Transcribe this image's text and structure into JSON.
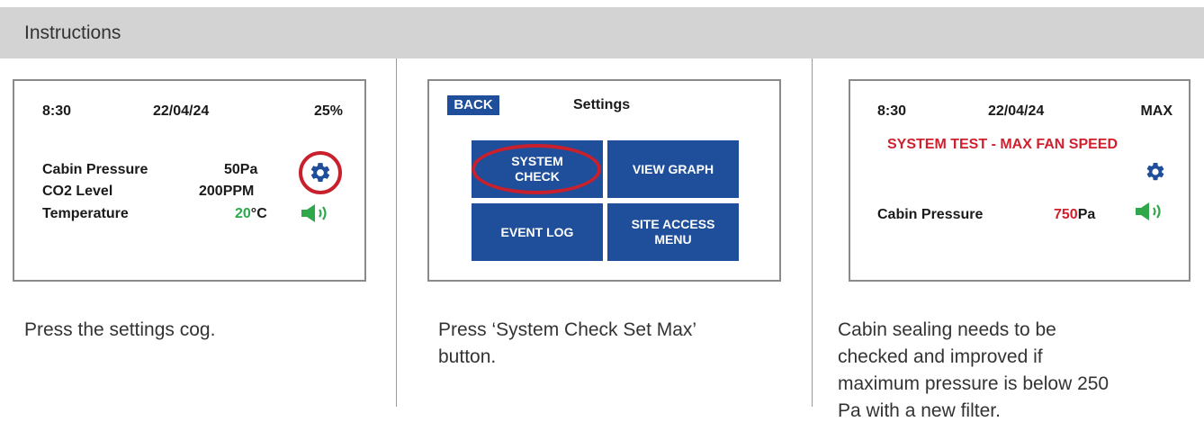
{
  "header": {
    "title": "Instructions"
  },
  "panel1": {
    "time": "8:30",
    "date": "22/04/24",
    "level": "25%",
    "rows": [
      {
        "label": "Cabin Pressure",
        "value": "50Pa"
      },
      {
        "label": "CO2 Level",
        "value": "200PPM"
      },
      {
        "label": "Temperature",
        "value_num": "20",
        "value_unit": "°C"
      }
    ],
    "caption": "Press the settings cog."
  },
  "panel2": {
    "back_label": "BACK",
    "title": "Settings",
    "buttons": [
      {
        "line1": "SYSTEM",
        "line2": "CHECK"
      },
      {
        "line1": "VIEW GRAPH",
        "line2": ""
      },
      {
        "line1": "EVENT LOG",
        "line2": ""
      },
      {
        "line1": "SITE ACCESS",
        "line2": "MENU"
      }
    ],
    "caption_line1": "Press ‘System Check Set Max’",
    "caption_line2": "button."
  },
  "panel3": {
    "time": "8:30",
    "date": "22/04/24",
    "level": "MAX",
    "alert": "SYSTEM TEST - MAX FAN SPEED",
    "pressure_label": "Cabin Pressure",
    "pressure_num": "750",
    "pressure_unit": "Pa",
    "caption_lines": [
      "Cabin sealing needs to be",
      "checked and improved if",
      "maximum pressure is below 250",
      "Pa with a new filter."
    ]
  },
  "colors": {
    "accent_blue": "#1f4e9a",
    "alert_red": "#d0202e",
    "ok_green": "#2ea84a",
    "header_gray": "#d3d3d3"
  },
  "icons": [
    "gear-icon",
    "speaker-icon"
  ]
}
